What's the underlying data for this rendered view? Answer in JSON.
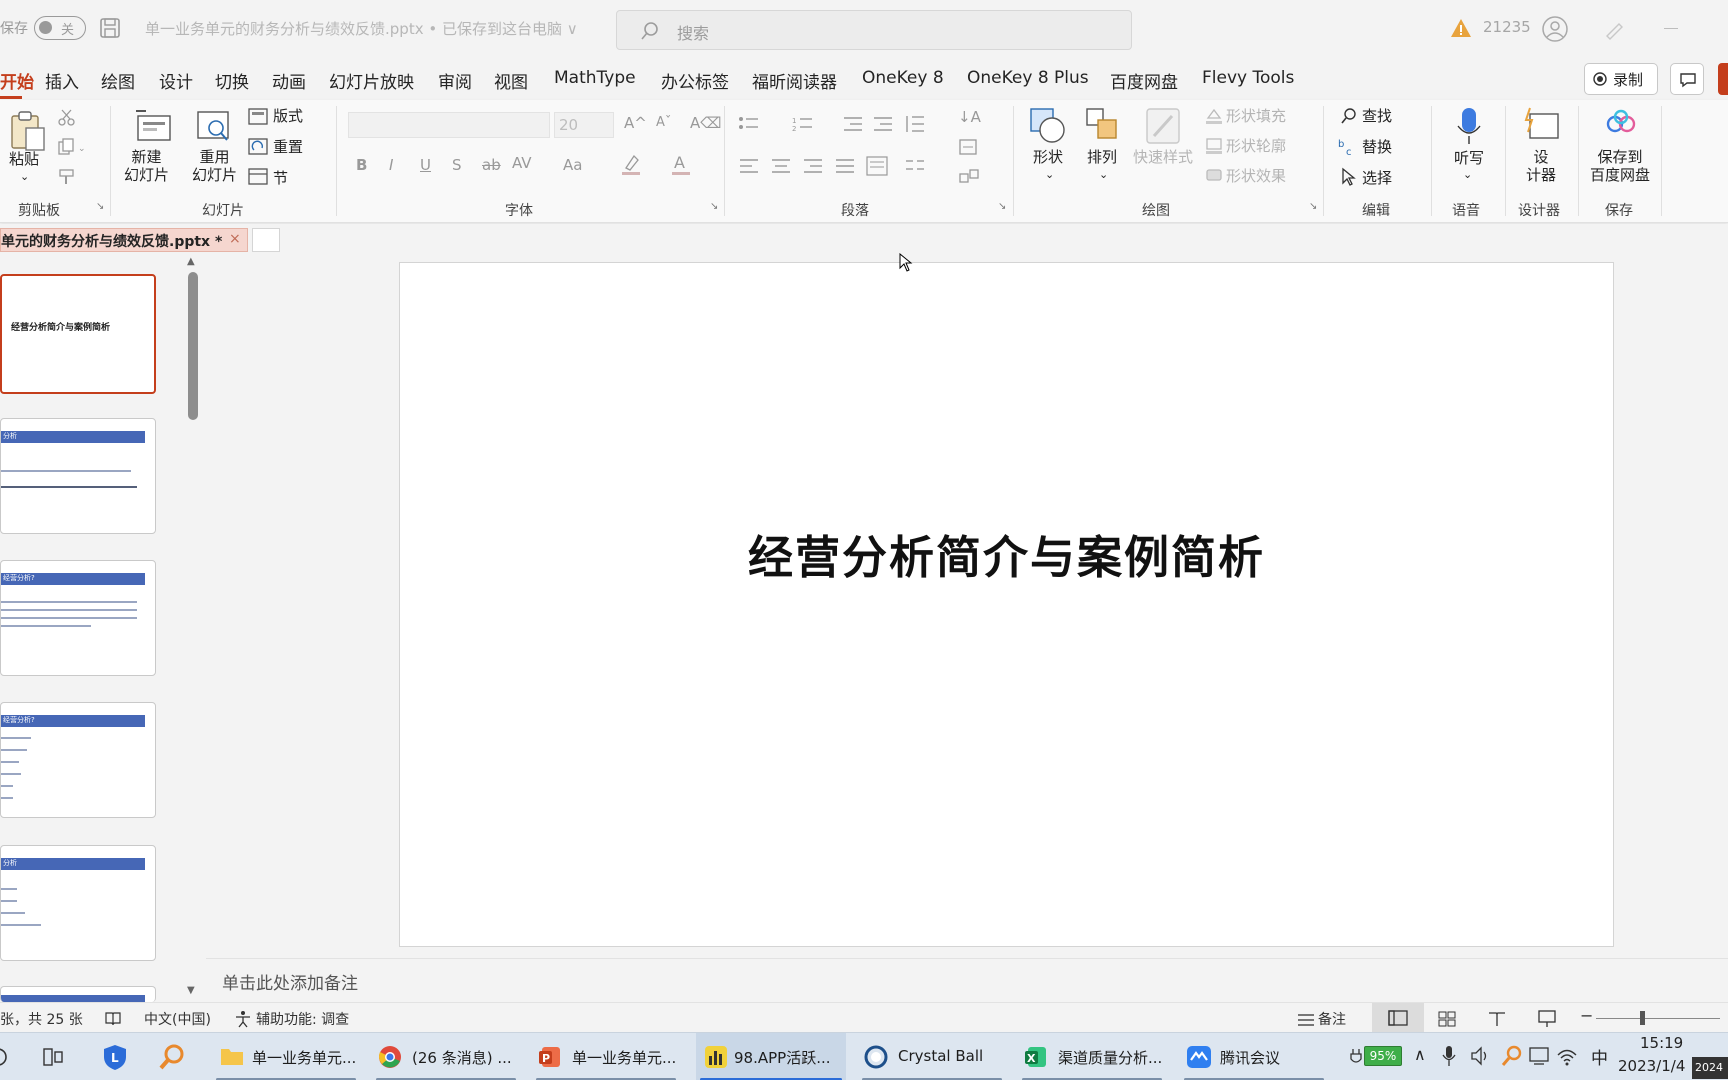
{
  "titlebar": {
    "autosave_label": "保存",
    "autosave_state": "关",
    "doc_title": "单一业务单元的财务分析与绩效反馈.pptx • 已保存到这台电脑 ∨",
    "search_placeholder": "搜索",
    "warning_count": "21235"
  },
  "menu": {
    "tabs": [
      "开始",
      "插入",
      "绘图",
      "设计",
      "切换",
      "动画",
      "幻灯片放映",
      "审阅",
      "视图",
      "MathType",
      "办公标签",
      "福昕阅读器",
      "OneKey 8",
      "OneKey 8 Plus",
      "百度网盘",
      "Flevy Tools"
    ],
    "active": "开始",
    "record_label": "录制"
  },
  "ribbon": {
    "clipboard": {
      "paste": "粘贴",
      "group": "剪贴板"
    },
    "slides": {
      "new_slide": "新建\n幻灯片",
      "reuse_slide": "重用\n幻灯片",
      "layout": "版式",
      "reset": "重置",
      "section": "节",
      "group": "幻灯片"
    },
    "font": {
      "size": "20",
      "group": "字体"
    },
    "paragraph": {
      "group": "段落"
    },
    "drawing": {
      "shapes": "形状",
      "arrange": "排列",
      "quick_styles": "快速样式",
      "shape_fill": "形状填充",
      "shape_outline": "形状轮廓",
      "shape_effects": "形状效果",
      "group": "绘图"
    },
    "editing": {
      "find": "查找",
      "replace": "替换",
      "select": "选择",
      "group": "编辑"
    },
    "voice": {
      "dictate": "听写",
      "group": "语音"
    },
    "designer": {
      "label": "设\n计器",
      "group": "设计器"
    },
    "save": {
      "label": "保存到\n百度网盘",
      "group": "保存"
    }
  },
  "doc_tab": {
    "label": "单元的财务分析与绩效反馈.pptx *"
  },
  "slide": {
    "title": "经营分析简介与案例简析"
  },
  "thumbnails": [
    {
      "index": 1,
      "title": "经营分析简介与案例简析",
      "selected": true
    },
    {
      "index": 2,
      "title": "分析",
      "selected": false
    },
    {
      "index": 3,
      "title": "经营分析?",
      "selected": false
    },
    {
      "index": 4,
      "title": "经营分析?",
      "selected": false
    },
    {
      "index": 5,
      "title": "分析",
      "selected": false
    }
  ],
  "notes_placeholder": "单击此处添加备注",
  "status": {
    "slide_count": "张，共 25 张",
    "language": "中文(中国)",
    "accessibility": "辅助功能: 调查",
    "notes": "备注"
  },
  "taskbar": {
    "items": [
      {
        "label": "单一业务单元...",
        "icon": "folder-icon"
      },
      {
        "label": "(26 条消息) ...",
        "icon": "chrome-icon"
      },
      {
        "label": "单一业务单元...",
        "icon": "powerpoint-icon"
      },
      {
        "label": "98.APP活跃...",
        "icon": "chart-app-icon"
      },
      {
        "label": "Crystal Ball",
        "icon": "crystal-ball-icon"
      },
      {
        "label": "渠道质量分析...",
        "icon": "excel-icon"
      },
      {
        "label": "腾讯会议",
        "icon": "tencent-meeting-icon"
      }
    ],
    "battery": "95%",
    "ime": "中",
    "time": "15:19",
    "date": "2023/1/4",
    "date_badge": "2024"
  },
  "colors": {
    "accent": "#c43e1c",
    "thumb_header": "#4667b6"
  }
}
